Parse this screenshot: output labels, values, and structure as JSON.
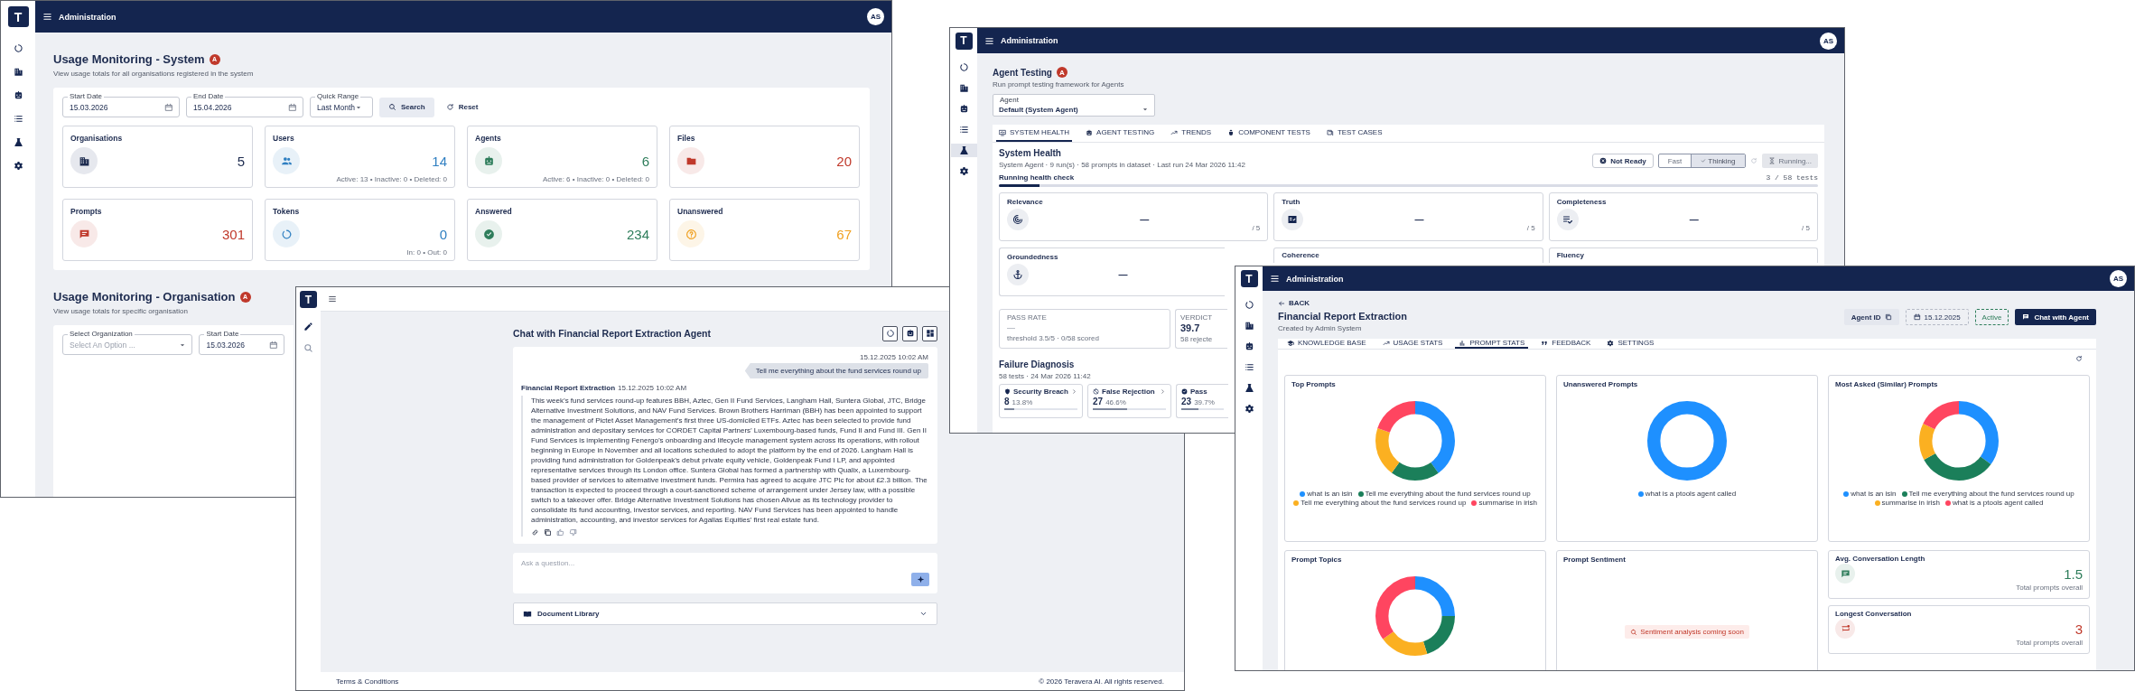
{
  "usage_window": {
    "header": {
      "logo": "T",
      "title": "Administration",
      "avatar": "AS"
    },
    "system": {
      "title": "Usage Monitoring - System",
      "badge": "A",
      "subtitle": "View usage totals for all organisations registered in the system",
      "filters": [
        {
          "kind": "date",
          "label": "Start Date",
          "value": "15.03.2026"
        },
        {
          "kind": "date",
          "label": "End Date",
          "value": "15.04.2026"
        },
        {
          "kind": "select",
          "label": "Quick Range",
          "value": "Last Month"
        }
      ],
      "search_button": "Search",
      "reset_button": "Reset",
      "stats": [
        {
          "label": "Organisations",
          "value": "5",
          "color": "#1d2b4f"
        },
        {
          "label": "Users",
          "value": "14",
          "color": "#2f7fc1",
          "note": "Active: 13 • Inactive: 0 • Deleted: 0"
        },
        {
          "label": "Agents",
          "value": "6",
          "color": "#2e7d5b",
          "note": "Active: 6 • Inactive: 0 • Deleted: 0"
        },
        {
          "label": "Files",
          "value": "20",
          "color": "#c0392b"
        },
        {
          "label": "Prompts",
          "value": "301",
          "color": "#c0392b"
        },
        {
          "label": "Tokens",
          "value": "0",
          "color": "#2f7fc1",
          "note": "In: 0 • Out: 0"
        },
        {
          "label": "Answered",
          "value": "234",
          "color": "#2e7d5b"
        },
        {
          "label": "Unanswered",
          "value": "67",
          "color": "#f0a020"
        }
      ]
    },
    "organisation": {
      "title": "Usage Monitoring - Organisation",
      "badge": "A",
      "subtitle": "View usage totals for specific organisation",
      "filters": [
        {
          "kind": "select",
          "label": "Select Organization",
          "placeholder": "Select An Option ..."
        },
        {
          "kind": "date",
          "label": "Start Date",
          "value": "15.03.2026"
        }
      ]
    }
  },
  "chat_window": {
    "logo": "T",
    "title": "Chat with Financial Report Extraction Agent",
    "messages": [
      {
        "kind": "user",
        "time": "15.12.2025 10:02 AM",
        "text": "Tell me everything about the fund services round up"
      },
      {
        "kind": "agent",
        "sender": "Financial Report Extraction",
        "time": "15.12.2025 10:02 AM",
        "text": "This week’s fund services round-up features BBH, Aztec, Gen II Fund Services, Langham Hall, Suntera Global, JTC, Bridge Alternative Investment Solutions, and NAV Fund Services. Brown Brothers Harriman (BBH) has been appointed to support the management of Pictet Asset Management’s first three US-domiciled ETFs. Aztec has been selected to provide fund administration and depositary services for CORDET Capital Partners’ Luxembourg-based funds, Fund II and Fund III. Gen II Fund Services is implementing Fenergo’s onboarding and lifecycle management system across its operations, with rollout beginning in Europe in November and all locations scheduled to adopt the platform by the end of 2026. Langham Hall is providing fund administration for Goldenpeak’s debut private equity vehicle, Goldenpeak Fund I LP, and appointed representative services through its London office. Suntera Global has formed a partnership with Qualix, a Luxembourg-based provider of services to alternative investment funds. Permira has agreed to acquire JTC Plc for about £2.3 billion. The transaction is expected to proceed through a court-sanctioned scheme of arrangement under Jersey law, with a possible switch to a takeover offer. Bridge Alternative Investment Solutions has chosen Allvue as its technology provider to consolidate its fund accounting, investor services, and reporting. NAV Fund Services has been appointed to handle administration, accounting, and investor services for Agallas Equities’ first real estate fund."
      }
    ],
    "input": {
      "placeholder": "Ask a question..."
    },
    "library": {
      "label": "Document Library",
      "expanded": false
    },
    "footer": {
      "left": "Terms & Conditions",
      "right": "© 2026 Teravera AI. All rights reserved."
    }
  },
  "testing_window": {
    "header": {
      "logo": "T",
      "title": "Administration",
      "avatar": "AS"
    },
    "nav": [
      {
        "selected": false
      },
      {
        "selected": false
      },
      {
        "selected": false
      },
      {
        "selected": false
      },
      {
        "selected": true
      },
      {
        "selected": false
      }
    ],
    "title": "Agent Testing",
    "badge": "A",
    "subtitle": "Run prompt testing framework for Agents",
    "agent_select": {
      "label": "Agent",
      "value": "Default (System Agent)"
    },
    "tabs": [
      {
        "label": "SYSTEM HEALTH",
        "selected": true
      },
      {
        "label": "AGENT TESTING",
        "selected": false
      },
      {
        "label": "TRENDS",
        "selected": false
      },
      {
        "label": "COMPONENT TESTS",
        "selected": false
      },
      {
        "label": "TEST CASES",
        "selected": false
      }
    ],
    "health": {
      "title": "System Health",
      "meta": "System Agent · 9 run(s) · 58 prompts in dataset · Last run 24 Mar 2026 11:42",
      "status_button": "Not Ready",
      "modes": [
        {
          "label": "Fast",
          "selected": false
        },
        {
          "label": "Thinking",
          "selected": true
        }
      ],
      "run_button": {
        "label": "Running...",
        "disabled": true
      },
      "progress": {
        "label": "Running health check",
        "count": "3 / 58 tests",
        "level": 0.05
      },
      "metrics": [
        {
          "label": "Relevance",
          "value": "—",
          "scale": "/ 5"
        },
        {
          "label": "Truth",
          "value": "—",
          "scale": "/ 5"
        },
        {
          "label": "Completeness",
          "value": "—",
          "scale": "/ 5"
        },
        {
          "label": "Groundedness",
          "value": "—"
        },
        {
          "label": "Coherence"
        },
        {
          "label": "Fluency"
        }
      ],
      "pass_rate": {
        "label": "PASS RATE",
        "value": "—",
        "note": "threshold 3.5/5 · 0/58 scored"
      },
      "verdict": {
        "label": "VERDICT",
        "value": "39.7",
        "note": "58 rejecte"
      }
    },
    "diagnosis": {
      "title": "Failure Diagnosis",
      "meta": "58 tests · 24 Mar 2026 11:42",
      "items": [
        {
          "label": "Security Breach",
          "count": "8",
          "share": "13.8%",
          "level": 0.138
        },
        {
          "label": "False Rejection",
          "count": "27",
          "share": "46.6%",
          "level": 0.466
        },
        {
          "label": "Pass",
          "count": "23",
          "share": "39.7%",
          "level": 0.397
        }
      ]
    }
  },
  "agent_window": {
    "header": {
      "logo": "T",
      "title": "Administration",
      "avatar": "AS"
    },
    "back": "BACK",
    "title": "Financial Report Extraction",
    "subtitle": "Created by Admin System",
    "agent_id_button": "Agent ID",
    "date": "15.12.2025",
    "status": "Active",
    "chat_button": "Chat with Agent",
    "tabs": [
      {
        "label": "KNOWLEDGE BASE",
        "selected": false
      },
      {
        "label": "USAGE STATS",
        "selected": false
      },
      {
        "label": "PROMPT STATS",
        "selected": true
      },
      {
        "label": "FEEDBACK",
        "selected": false
      },
      {
        "label": "SETTINGS",
        "selected": false
      }
    ],
    "charts": [
      {
        "title": "Top Prompts",
        "legend": [
          {
            "label": "what is an isin",
            "color": "#1e90ff"
          },
          {
            "label": "Tell me everything about the fund services round up",
            "color": "#1b7f5a"
          },
          {
            "label": "Tell me everything about the fund services round up",
            "color": "#fbb021"
          },
          {
            "label": "summarise in irish",
            "color": "#ff4560"
          }
        ]
      },
      {
        "title": "Unanswered Prompts",
        "legend": [
          {
            "label": "what is a ptools agent called",
            "color": "#1e90ff"
          }
        ]
      },
      {
        "title": "Most Asked (Similar) Prompts",
        "legend": [
          {
            "label": "what is an isin",
            "color": "#1e90ff"
          },
          {
            "label": "Tell me everything about the fund services round up",
            "color": "#1b7f5a"
          },
          {
            "label": "summarise in irish",
            "color": "#fbb021"
          },
          {
            "label": "what is a ptools agent called",
            "color": "#ff4560"
          }
        ]
      },
      {
        "title": "Prompt Topics"
      }
    ],
    "sentiment": {
      "title": "Prompt Sentiment",
      "notice": "Sentiment analysis coming soon"
    },
    "metrics": [
      {
        "title": "Avg. Conversation Length",
        "value": "1.5",
        "note": "Total prompts overall",
        "color": "#2e7d5b"
      },
      {
        "title": "Longest Conversation",
        "value": "3",
        "note": "Total prompts overall",
        "color": "#c0392b"
      }
    ]
  }
}
